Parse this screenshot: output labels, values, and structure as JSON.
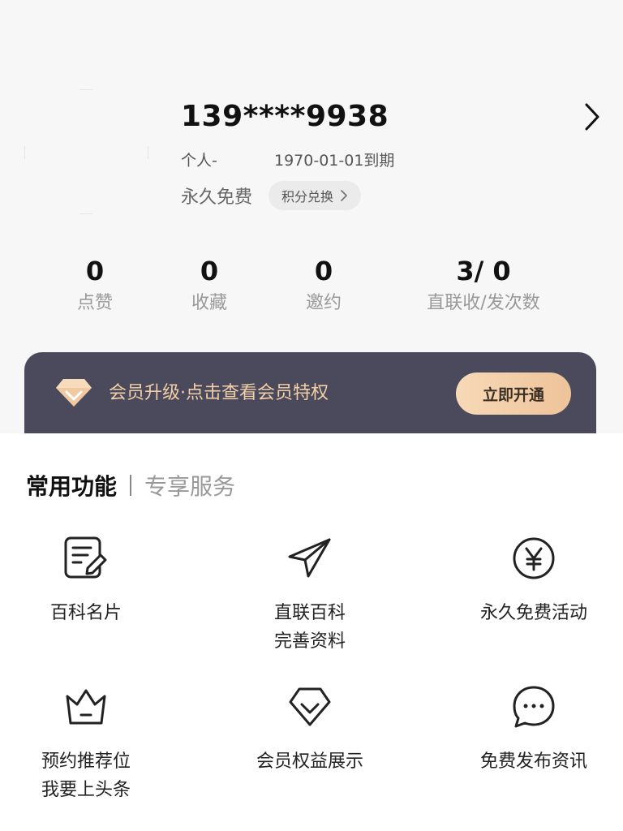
{
  "profile": {
    "phone": "139****9938",
    "plan_type": "个人-",
    "expiry": "1970-01-01到期",
    "membership": "永久免费",
    "points_button": "积分兑换"
  },
  "stats": [
    {
      "value": "0",
      "label": "点赞"
    },
    {
      "value": "0",
      "label": "收藏"
    },
    {
      "value": "0",
      "label": "邀约"
    },
    {
      "value": "3/ 0",
      "label": "直联收/发次数"
    }
  ],
  "vip_banner": {
    "text": "会员升级·点击查看会员特权",
    "button": "立即开通"
  },
  "tabs": {
    "common": "常用功能",
    "exclusive": "专享服务"
  },
  "features": [
    {
      "icon": "edit-document-icon",
      "line1": "百科名片",
      "line2": ""
    },
    {
      "icon": "paper-plane-icon",
      "line1": "直联百科",
      "line2": "完善资料"
    },
    {
      "icon": "yen-circle-icon",
      "line1": "永久免费活动",
      "line2": ""
    },
    {
      "icon": "crown-icon",
      "line1": "预约推荐位",
      "line2": "我要上头条"
    },
    {
      "icon": "diamond-icon",
      "line1": "会员权益展示",
      "line2": ""
    },
    {
      "icon": "chat-bubble-icon",
      "line1": "免费发布资讯",
      "line2": ""
    }
  ],
  "colors": {
    "banner_bg": "#4a4a5c",
    "banner_text": "#f2cfa6",
    "button_gradient_start": "#f7d9b6",
    "button_gradient_end": "#eec39a"
  }
}
